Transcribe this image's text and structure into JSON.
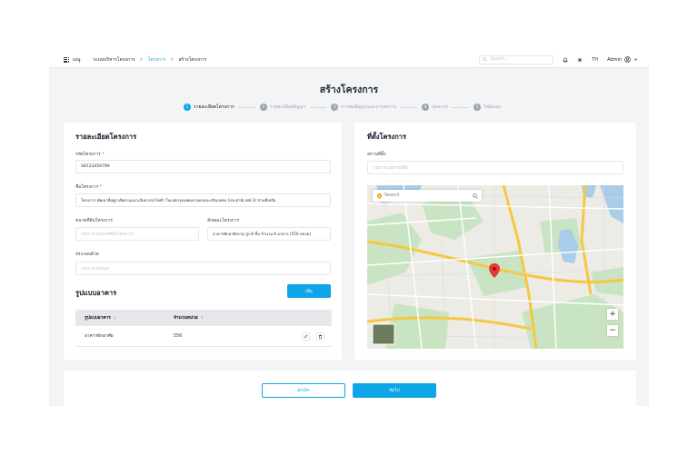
{
  "topbar": {
    "menu_label": "เมนู",
    "breadcrumbs": [
      "ระบบบริหารโครงการ",
      "โครงการ",
      "สร้างโครงการ"
    ],
    "breadcrumb_sep": ">",
    "search_placeholder": "Search...",
    "lang": "TH",
    "user": "Admin",
    "icons": [
      "grid-icon",
      "search-icon",
      "bell-icon",
      "sun-icon",
      "user-icon",
      "chevron-down-icon"
    ]
  },
  "page_title": "สร้างโครงการ",
  "steps": [
    {
      "num": "1",
      "label": "รายละเอียดโครงการ",
      "active": true
    },
    {
      "num": "2",
      "label": "รายละเอียดสัญญา",
      "active": false
    },
    {
      "num": "3",
      "label": "การต่อสัญญาและการส่งงาน",
      "active": false
    },
    {
      "num": "4",
      "label": "บุคลากร",
      "active": false
    },
    {
      "num": "5",
      "label": "ไฟล์แนบ",
      "active": false
    }
  ],
  "project": {
    "section_title": "รายละเอียดโครงการ",
    "code_label": "รหัสโครงการ",
    "code_value": "SB123456789",
    "name_label": "ชื่อโครงการ",
    "name_value": "โครงการ พัฒนาที่อยู่อาศัยตามแนวเส้นทางรถไฟฟ้า ในเขตกรุงเทพมหานครและปริมณฑล (ประชานิเวศน์ 3) ส่วนที่เหลือ",
    "area_label": "ขนาดที่ดินโครงการ",
    "area_placeholder": "กรุณาระบุขนาดที่ดินโครงการ",
    "feature_label": "ลักษณะโครงการ",
    "feature_value": "อาคารพักอาศัยรวม สูง 8 ชั้น จำนวน 6 อาคาร (556 หน่วย)",
    "consist_label": "ประกอบด้วย",
    "consist_placeholder": "กรุณาระบุข้อมูล",
    "required_mark": "*"
  },
  "building": {
    "section_title": "รูปแบบอาคาร",
    "add_button": "เพิ่ม",
    "columns": [
      "รูปแบบอาคาร",
      "จำนวนหน่วย"
    ],
    "sort_glyph": "⇕",
    "rows": [
      {
        "type": "อาคารพักอาศัย",
        "units": "556"
      }
    ]
  },
  "location": {
    "section_title": "ที่ตั้งโครงการ",
    "location_label": "สถานที่ตั้ง",
    "location_placeholder": "กรุณาระบุสถานที่ตั้ง",
    "map_search_placeholder": "Search",
    "zoom_in": "+",
    "zoom_out": "−"
  },
  "actions": {
    "cancel": "ยกเลิก",
    "next": "ถัดไป"
  },
  "colors": {
    "accent": "#0ea5e9",
    "required": "#ef4444",
    "map_pin": "#e53935"
  }
}
